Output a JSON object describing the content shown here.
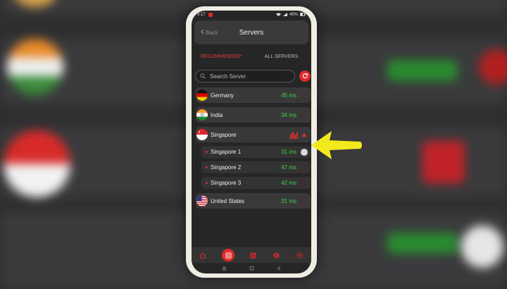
{
  "statusbar": {
    "time": "9:17",
    "battery": "45%"
  },
  "header": {
    "back_label": "Back",
    "title": "Servers"
  },
  "tabs": [
    {
      "label": "RECOMMENDED*",
      "active": true
    },
    {
      "label": "ALL SERVERS",
      "active": false
    }
  ],
  "search": {
    "placeholder": "Search Server"
  },
  "servers": [
    {
      "name": "Germany",
      "ping": "45 ms"
    },
    {
      "name": "India",
      "ping": "34 ms"
    },
    {
      "name": "Singapore",
      "expanded": true,
      "locations": [
        {
          "name": "Singapore 1",
          "ping": "31 ms",
          "selected": true
        },
        {
          "name": "Singapore 2",
          "ping": "47 ms"
        },
        {
          "name": "Singapore 3",
          "ping": "42 ms"
        }
      ]
    },
    {
      "name": "United States",
      "ping": "31 ms"
    }
  ],
  "bottom_nav": [
    "home-icon",
    "server-list-icon",
    "rss-icon",
    "account-icon",
    "settings-icon"
  ],
  "colors": {
    "accent": "#e02a2a",
    "ping": "#3fcf4a",
    "pointer_arrow": "#f2ea1c"
  }
}
